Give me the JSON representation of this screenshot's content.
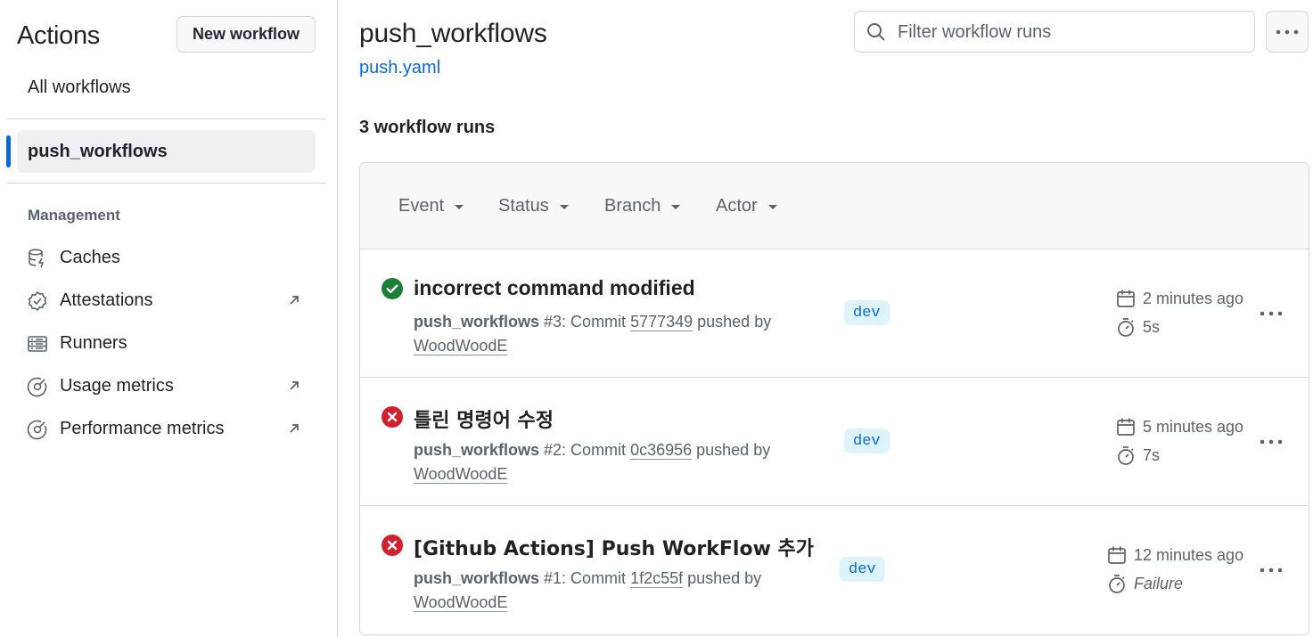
{
  "sidebar": {
    "title": "Actions",
    "new_workflow_label": "New workflow",
    "all_workflows_label": "All workflows",
    "active_workflow": "push_workflows",
    "management_heading": "Management",
    "items": [
      {
        "label": "Caches",
        "icon": "database-icon",
        "external": false
      },
      {
        "label": "Attestations",
        "icon": "verified-icon",
        "external": true
      },
      {
        "label": "Runners",
        "icon": "server-icon",
        "external": false
      },
      {
        "label": "Usage metrics",
        "icon": "meter-icon",
        "external": true
      },
      {
        "label": "Performance metrics",
        "icon": "meter-icon",
        "external": true
      }
    ]
  },
  "header": {
    "title": "push_workflows",
    "file_link": "push.yaml",
    "search_placeholder": "Filter workflow runs"
  },
  "runs_count_label": "3 workflow runs",
  "filters": [
    "Event",
    "Status",
    "Branch",
    "Actor"
  ],
  "runs": [
    {
      "status": "success",
      "title": "incorrect command modified",
      "workflow": "push_workflows",
      "meta_prefix": " #3: Commit ",
      "commit": "5777349",
      "pushed_by_text": " pushed by",
      "actor": "WoodWoodE",
      "branch": "dev",
      "time_ago": "2 minutes ago",
      "duration": "5s"
    },
    {
      "status": "failure",
      "title": "틀린 명령어 수정",
      "workflow": "push_workflows",
      "meta_prefix": " #2: Commit ",
      "commit": "0c36956",
      "pushed_by_text": " pushed by",
      "actor": "WoodWoodE",
      "branch": "dev",
      "time_ago": "5 minutes ago",
      "duration": "7s"
    },
    {
      "status": "failure",
      "title": "[Github Actions] Push WorkFlow 추가",
      "workflow": "push_workflows",
      "meta_prefix": " #1: Commit ",
      "commit": "1f2c55f",
      "pushed_by_text": " pushed by",
      "actor": "WoodWoodE",
      "branch": "dev",
      "time_ago": "12 minutes ago",
      "duration": "Failure"
    }
  ],
  "colors": {
    "accent": "#0969da",
    "success": "#1a7f37",
    "failure": "#cf222e",
    "border": "#d1d9e0",
    "muted": "#59636e"
  }
}
